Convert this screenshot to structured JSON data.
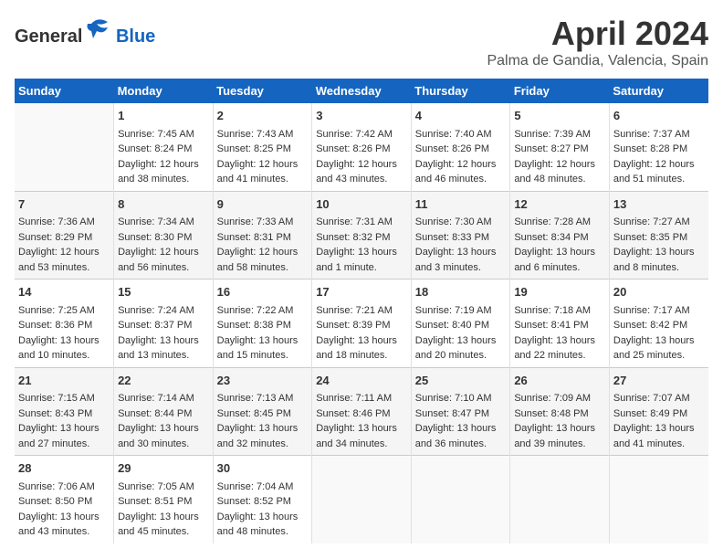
{
  "header": {
    "logo_general": "General",
    "logo_blue": "Blue",
    "month_title": "April 2024",
    "location": "Palma de Gandia, Valencia, Spain"
  },
  "calendar": {
    "days_of_week": [
      "Sunday",
      "Monday",
      "Tuesday",
      "Wednesday",
      "Thursday",
      "Friday",
      "Saturday"
    ],
    "weeks": [
      [
        {
          "day": "",
          "content": ""
        },
        {
          "day": "1",
          "content": "Sunrise: 7:45 AM\nSunset: 8:24 PM\nDaylight: 12 hours\nand 38 minutes."
        },
        {
          "day": "2",
          "content": "Sunrise: 7:43 AM\nSunset: 8:25 PM\nDaylight: 12 hours\nand 41 minutes."
        },
        {
          "day": "3",
          "content": "Sunrise: 7:42 AM\nSunset: 8:26 PM\nDaylight: 12 hours\nand 43 minutes."
        },
        {
          "day": "4",
          "content": "Sunrise: 7:40 AM\nSunset: 8:26 PM\nDaylight: 12 hours\nand 46 minutes."
        },
        {
          "day": "5",
          "content": "Sunrise: 7:39 AM\nSunset: 8:27 PM\nDaylight: 12 hours\nand 48 minutes."
        },
        {
          "day": "6",
          "content": "Sunrise: 7:37 AM\nSunset: 8:28 PM\nDaylight: 12 hours\nand 51 minutes."
        }
      ],
      [
        {
          "day": "7",
          "content": "Sunrise: 7:36 AM\nSunset: 8:29 PM\nDaylight: 12 hours\nand 53 minutes."
        },
        {
          "day": "8",
          "content": "Sunrise: 7:34 AM\nSunset: 8:30 PM\nDaylight: 12 hours\nand 56 minutes."
        },
        {
          "day": "9",
          "content": "Sunrise: 7:33 AM\nSunset: 8:31 PM\nDaylight: 12 hours\nand 58 minutes."
        },
        {
          "day": "10",
          "content": "Sunrise: 7:31 AM\nSunset: 8:32 PM\nDaylight: 13 hours\nand 1 minute."
        },
        {
          "day": "11",
          "content": "Sunrise: 7:30 AM\nSunset: 8:33 PM\nDaylight: 13 hours\nand 3 minutes."
        },
        {
          "day": "12",
          "content": "Sunrise: 7:28 AM\nSunset: 8:34 PM\nDaylight: 13 hours\nand 6 minutes."
        },
        {
          "day": "13",
          "content": "Sunrise: 7:27 AM\nSunset: 8:35 PM\nDaylight: 13 hours\nand 8 minutes."
        }
      ],
      [
        {
          "day": "14",
          "content": "Sunrise: 7:25 AM\nSunset: 8:36 PM\nDaylight: 13 hours\nand 10 minutes."
        },
        {
          "day": "15",
          "content": "Sunrise: 7:24 AM\nSunset: 8:37 PM\nDaylight: 13 hours\nand 13 minutes."
        },
        {
          "day": "16",
          "content": "Sunrise: 7:22 AM\nSunset: 8:38 PM\nDaylight: 13 hours\nand 15 minutes."
        },
        {
          "day": "17",
          "content": "Sunrise: 7:21 AM\nSunset: 8:39 PM\nDaylight: 13 hours\nand 18 minutes."
        },
        {
          "day": "18",
          "content": "Sunrise: 7:19 AM\nSunset: 8:40 PM\nDaylight: 13 hours\nand 20 minutes."
        },
        {
          "day": "19",
          "content": "Sunrise: 7:18 AM\nSunset: 8:41 PM\nDaylight: 13 hours\nand 22 minutes."
        },
        {
          "day": "20",
          "content": "Sunrise: 7:17 AM\nSunset: 8:42 PM\nDaylight: 13 hours\nand 25 minutes."
        }
      ],
      [
        {
          "day": "21",
          "content": "Sunrise: 7:15 AM\nSunset: 8:43 PM\nDaylight: 13 hours\nand 27 minutes."
        },
        {
          "day": "22",
          "content": "Sunrise: 7:14 AM\nSunset: 8:44 PM\nDaylight: 13 hours\nand 30 minutes."
        },
        {
          "day": "23",
          "content": "Sunrise: 7:13 AM\nSunset: 8:45 PM\nDaylight: 13 hours\nand 32 minutes."
        },
        {
          "day": "24",
          "content": "Sunrise: 7:11 AM\nSunset: 8:46 PM\nDaylight: 13 hours\nand 34 minutes."
        },
        {
          "day": "25",
          "content": "Sunrise: 7:10 AM\nSunset: 8:47 PM\nDaylight: 13 hours\nand 36 minutes."
        },
        {
          "day": "26",
          "content": "Sunrise: 7:09 AM\nSunset: 8:48 PM\nDaylight: 13 hours\nand 39 minutes."
        },
        {
          "day": "27",
          "content": "Sunrise: 7:07 AM\nSunset: 8:49 PM\nDaylight: 13 hours\nand 41 minutes."
        }
      ],
      [
        {
          "day": "28",
          "content": "Sunrise: 7:06 AM\nSunset: 8:50 PM\nDaylight: 13 hours\nand 43 minutes."
        },
        {
          "day": "29",
          "content": "Sunrise: 7:05 AM\nSunset: 8:51 PM\nDaylight: 13 hours\nand 45 minutes."
        },
        {
          "day": "30",
          "content": "Sunrise: 7:04 AM\nSunset: 8:52 PM\nDaylight: 13 hours\nand 48 minutes."
        },
        {
          "day": "",
          "content": ""
        },
        {
          "day": "",
          "content": ""
        },
        {
          "day": "",
          "content": ""
        },
        {
          "day": "",
          "content": ""
        }
      ]
    ]
  }
}
